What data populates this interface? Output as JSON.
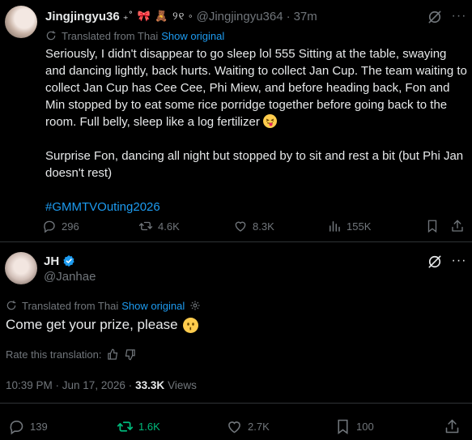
{
  "post1": {
    "author_name": "Jingjingyu36",
    "name_decoration": "₊˚ 🎀 🧸 ୨୧ ◦",
    "handle": "@Jingjingyu364",
    "time": "37m",
    "translated_label": "Translated from Thai",
    "show_original": "Show original",
    "body_p1": "Seriously, I didn't disappear to go sleep lol 555 Sitting at the table, swaying and dancing lightly, back hurts. Waiting to collect Jan Cup. The team waiting to collect Jan Cup has Cee Cee, Phi Miew, and before heading back, Fon and Min stopped by to eat some rice porridge together before going back to the room. Full belly, sleep like a log fertilizer",
    "body_p2": "Surprise Fon, dancing all night but stopped by to sit and rest a bit (but Phi Jan doesn't rest)",
    "hashtag": "#GMMTVOuting2026",
    "replies": "296",
    "reposts": "4.6K",
    "likes": "8.3K",
    "views": "155K"
  },
  "post2": {
    "author_name": "JH",
    "handle": "@Janhae",
    "translated_label": "Translated from Thai",
    "show_original": "Show original",
    "text": "Come get your prize, please",
    "rate_label": "Rate this translation:",
    "timestamp": "10:39 PM · Jun 17, 2026 ·",
    "view_count": "33.3K",
    "views_label": "Views",
    "replies": "139",
    "reposts": "1.6K",
    "likes": "2.7K",
    "bookmarks": "100"
  },
  "colors": {
    "background": "#000000",
    "text": "#e7e9ea",
    "secondary": "#71767b",
    "link": "#1d9bf0",
    "repost_active": "#00ba7c",
    "divider": "#2f3336"
  },
  "icons": {
    "mute": "mute-icon",
    "more": "more-icon",
    "translate": "translate-icon",
    "reply": "reply-icon",
    "repost": "repost-icon",
    "like": "like-icon",
    "views": "views-icon",
    "bookmark": "bookmark-icon",
    "share": "share-icon",
    "verified": "verified-badge-icon",
    "gear": "gear-icon",
    "thumbs_up": "thumbs-up-icon",
    "thumbs_down": "thumbs-down-icon"
  }
}
